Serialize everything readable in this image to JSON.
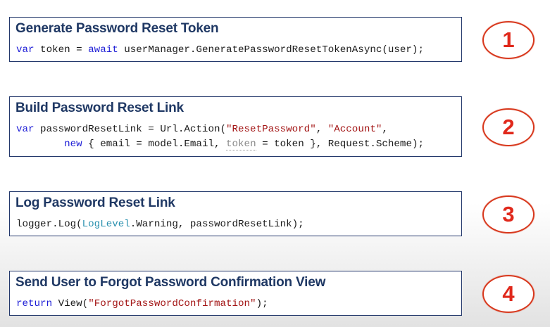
{
  "steps": [
    {
      "number": "1",
      "title": "Generate Password Reset Token",
      "code": {
        "line1": {
          "kw1": "var",
          "t1": " token = ",
          "kw2": "await",
          "t2": " userManager.GeneratePasswordResetTokenAsync(user);"
        }
      }
    },
    {
      "number": "2",
      "title": "Build Password Reset Link",
      "code": {
        "line1": {
          "kw1": "var",
          "t1": " passwordResetLink = Url.Action(",
          "s1": "\"ResetPassword\"",
          "t2": ", ",
          "s2": "\"Account\"",
          "t3": ","
        },
        "line2": {
          "indent": "        ",
          "kw1": "new",
          "t1": " { email = model.Email, ",
          "m1": "token",
          "t2": " = token }, Request.Scheme);"
        }
      }
    },
    {
      "number": "3",
      "title": "Log Password Reset Link",
      "code": {
        "line1": {
          "t1": "logger.Log(",
          "ty1": "LogLevel",
          "t2": ".Warning, passwordResetLink);"
        }
      }
    },
    {
      "number": "4",
      "title": "Send User to Forgot Password Confirmation View",
      "code": {
        "line1": {
          "kw1": "return",
          "t1": " View(",
          "s1": "\"ForgotPasswordConfirmation\"",
          "t2": ");"
        }
      }
    }
  ],
  "colors": {
    "title": "#1f3864",
    "keyword": "#1d1dd6",
    "string": "#a31515",
    "type": "#2b91af",
    "badge": "#e0281b",
    "border": "#23386b"
  }
}
